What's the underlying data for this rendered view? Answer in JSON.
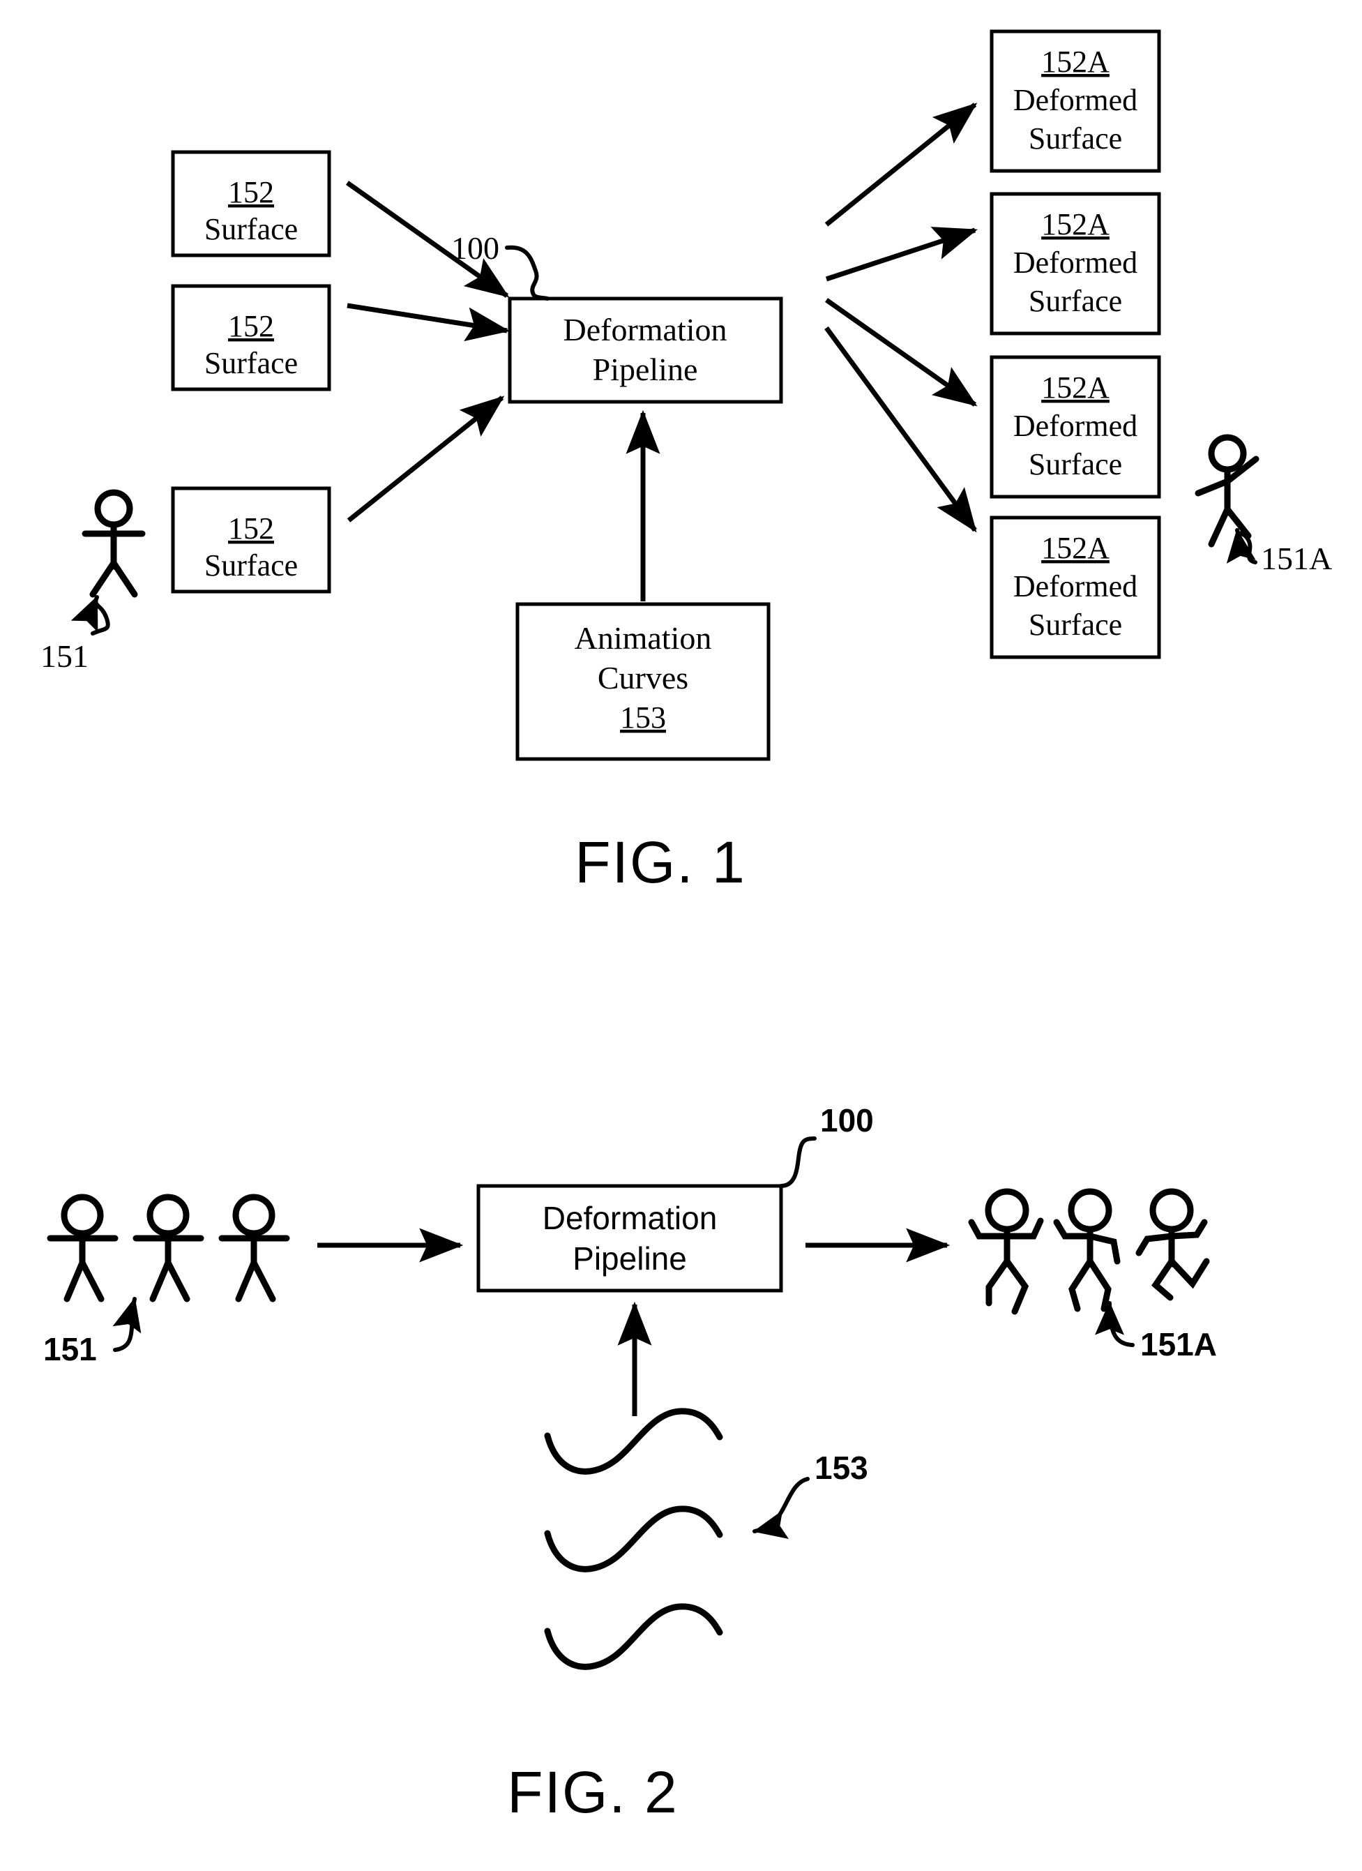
{
  "document": {
    "type": "patent-drawing-sheet",
    "figures": [
      {
        "id": "fig1",
        "caption": "FIG. 1",
        "system_ref": "100",
        "pipeline_title_line1": "Deformation",
        "pipeline_title_line2": "Pipeline",
        "input_boxes": [
          {
            "ref": "152",
            "label": "Surface"
          },
          {
            "ref": "152",
            "label": "Surface"
          },
          {
            "ref": "152",
            "label": "Surface"
          }
        ],
        "output_boxes": [
          {
            "ref": "152A",
            "label_line1": "Deformed",
            "label_line2": "Surface"
          },
          {
            "ref": "152A",
            "label_line1": "Deformed",
            "label_line2": "Surface"
          },
          {
            "ref": "152A",
            "label_line1": "Deformed",
            "label_line2": "Surface"
          },
          {
            "ref": "152A",
            "label_line1": "Deformed",
            "label_line2": "Surface"
          }
        ],
        "curves_box": {
          "line1": "Animation",
          "line2": "Curves",
          "ref": "153"
        },
        "character_in_ref": "151",
        "character_out_ref": "151A"
      },
      {
        "id": "fig2",
        "caption": "FIG. 2",
        "system_ref": "100",
        "pipeline_title_line1": "Deformation",
        "pipeline_title_line2": "Pipeline",
        "input_characters_ref": "151",
        "input_characters_count": 3,
        "output_characters_ref": "151A",
        "output_characters_count": 3,
        "animation_curves_ref": "153",
        "animation_curves_count": 3
      }
    ]
  },
  "colors": {
    "ink": "#000000",
    "paper": "#ffffff"
  }
}
